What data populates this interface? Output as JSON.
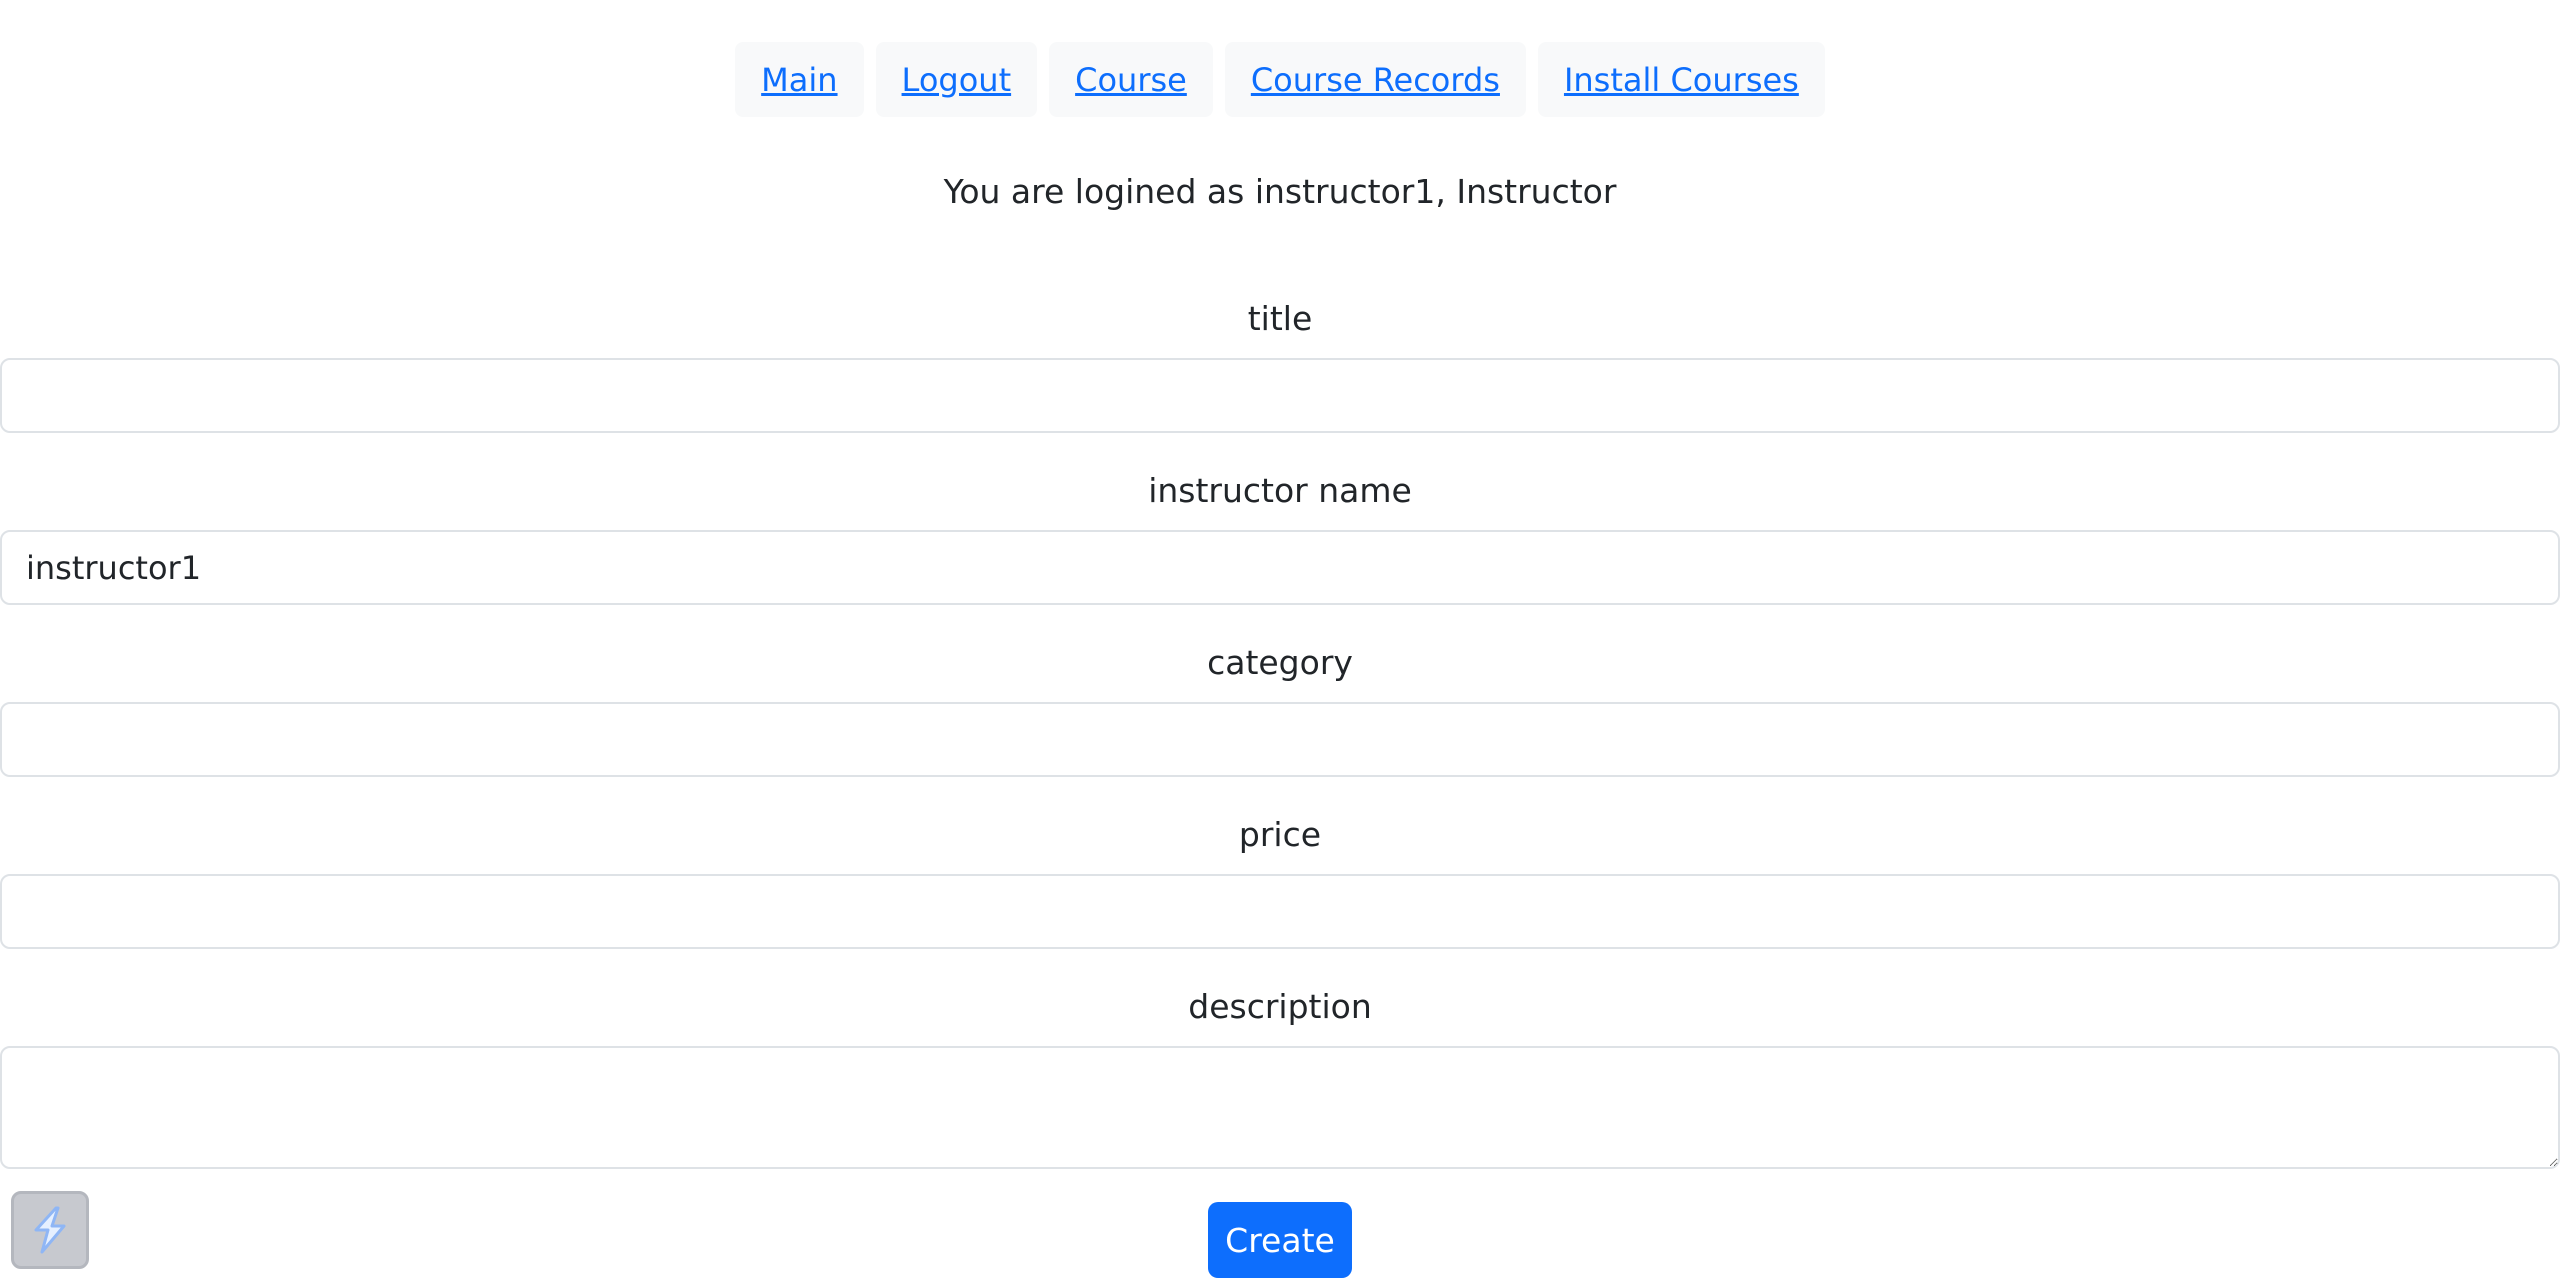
{
  "nav": {
    "items": [
      {
        "label": "Main"
      },
      {
        "label": "Logout"
      },
      {
        "label": "Course"
      },
      {
        "label": "Course Records"
      },
      {
        "label": "Install Courses"
      }
    ]
  },
  "status": {
    "login_text": "You are logined as instructor1, Instructor"
  },
  "form": {
    "title_label": "title",
    "title_value": "",
    "instructor_label": "instructor name",
    "instructor_value": "instructor1",
    "category_label": "category",
    "category_value": "",
    "price_label": "price",
    "price_value": "",
    "description_label": "description",
    "description_value": "",
    "submit_label": "Create"
  },
  "extension": {
    "icon": "lightning-bolt-icon"
  },
  "colors": {
    "link": "#0d6efd",
    "button_primary": "#0d6efd",
    "nav_bg": "#f8f9fa",
    "input_border": "#dee2e6"
  }
}
